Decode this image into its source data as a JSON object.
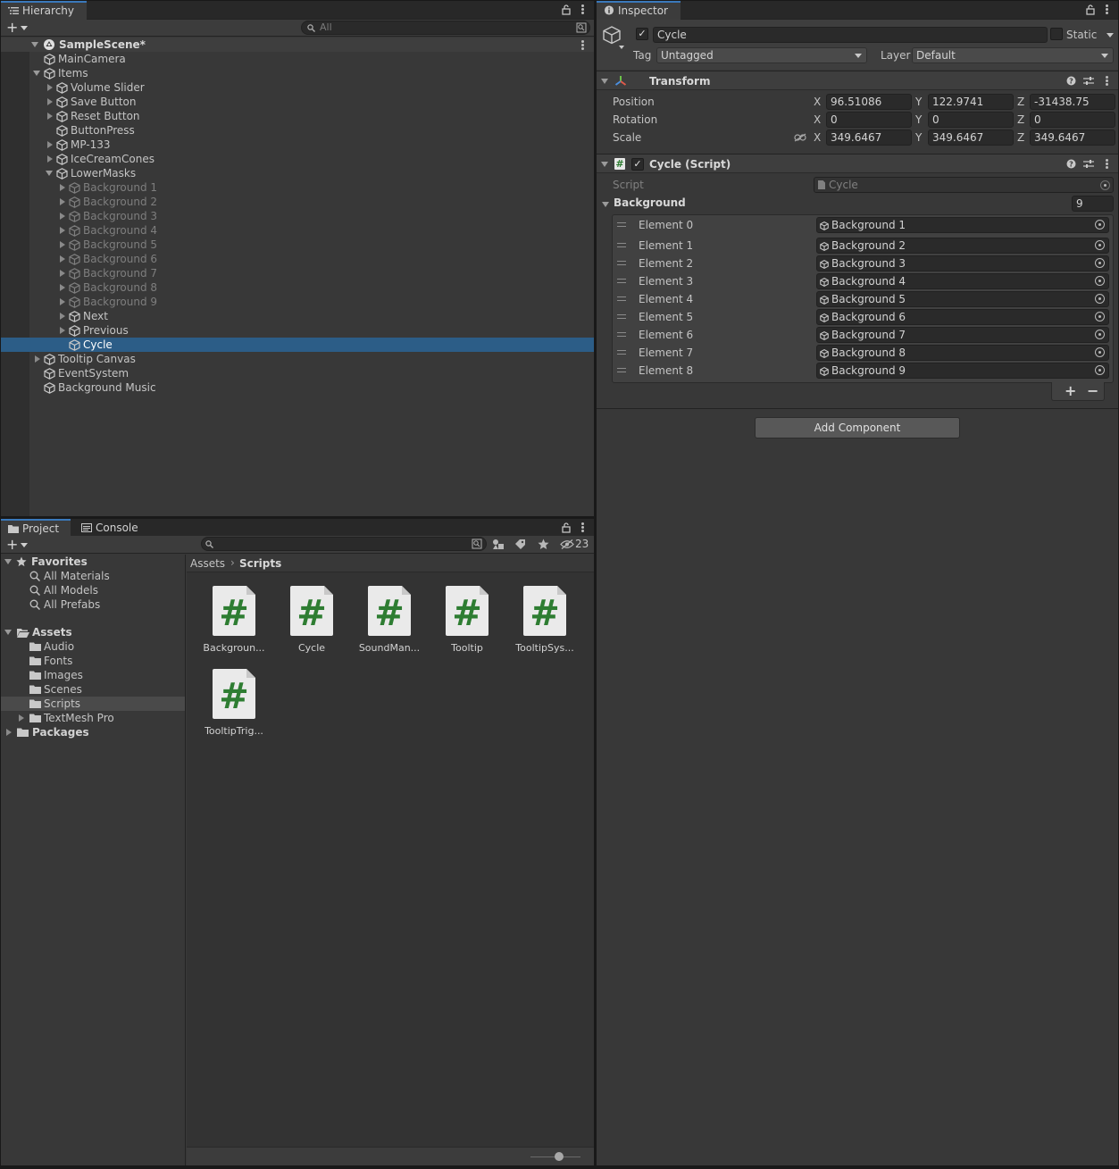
{
  "hierarchy": {
    "tab_label": "Hierarchy",
    "search_placeholder": "All",
    "scene_name": "SampleScene*",
    "items": [
      {
        "label": "MainCamera",
        "depth": 1,
        "expander": "none",
        "faded": false,
        "selected": false
      },
      {
        "label": "Items",
        "depth": 1,
        "expander": "open",
        "faded": false,
        "selected": false
      },
      {
        "label": "Volume Slider",
        "depth": 2,
        "expander": "closed",
        "faded": false,
        "selected": false
      },
      {
        "label": "Save Button",
        "depth": 2,
        "expander": "closed",
        "faded": false,
        "selected": false
      },
      {
        "label": "Reset Button",
        "depth": 2,
        "expander": "closed",
        "faded": false,
        "selected": false
      },
      {
        "label": "ButtonPress",
        "depth": 2,
        "expander": "none",
        "faded": false,
        "selected": false
      },
      {
        "label": "MP-133",
        "depth": 2,
        "expander": "closed",
        "faded": false,
        "selected": false
      },
      {
        "label": "IceCreamCones",
        "depth": 2,
        "expander": "closed",
        "faded": false,
        "selected": false
      },
      {
        "label": "LowerMasks",
        "depth": 2,
        "expander": "open",
        "faded": false,
        "selected": false
      },
      {
        "label": "Background 1",
        "depth": 3,
        "expander": "closed",
        "faded": true,
        "selected": false
      },
      {
        "label": "Background 2",
        "depth": 3,
        "expander": "closed",
        "faded": true,
        "selected": false
      },
      {
        "label": "Background 3",
        "depth": 3,
        "expander": "closed",
        "faded": true,
        "selected": false
      },
      {
        "label": "Background 4",
        "depth": 3,
        "expander": "closed",
        "faded": true,
        "selected": false
      },
      {
        "label": "Background 5",
        "depth": 3,
        "expander": "closed",
        "faded": true,
        "selected": false
      },
      {
        "label": "Background 6",
        "depth": 3,
        "expander": "closed",
        "faded": true,
        "selected": false
      },
      {
        "label": "Background 7",
        "depth": 3,
        "expander": "closed",
        "faded": true,
        "selected": false
      },
      {
        "label": "Background 8",
        "depth": 3,
        "expander": "closed",
        "faded": true,
        "selected": false
      },
      {
        "label": "Background 9",
        "depth": 3,
        "expander": "closed",
        "faded": true,
        "selected": false
      },
      {
        "label": "Next",
        "depth": 3,
        "expander": "closed",
        "faded": false,
        "selected": false
      },
      {
        "label": "Previous",
        "depth": 3,
        "expander": "closed",
        "faded": false,
        "selected": false
      },
      {
        "label": "Cycle",
        "depth": 3,
        "expander": "none",
        "faded": false,
        "selected": true
      },
      {
        "label": "Tooltip Canvas",
        "depth": 1,
        "expander": "closed",
        "faded": false,
        "selected": false
      },
      {
        "label": "EventSystem",
        "depth": 1,
        "expander": "none",
        "faded": false,
        "selected": false
      },
      {
        "label": "Background Music",
        "depth": 1,
        "expander": "none",
        "faded": false,
        "selected": false
      }
    ]
  },
  "project": {
    "tabs": [
      "Project",
      "Console"
    ],
    "hidden_count": "23",
    "favorites_label": "Favorites",
    "favorites": [
      "All Materials",
      "All Models",
      "All Prefabs"
    ],
    "assets_label": "Assets",
    "asset_folders": [
      {
        "label": "Audio",
        "expander": false,
        "selected": false
      },
      {
        "label": "Fonts",
        "expander": false,
        "selected": false
      },
      {
        "label": "Images",
        "expander": false,
        "selected": false
      },
      {
        "label": "Scenes",
        "expander": false,
        "selected": false
      },
      {
        "label": "Scripts",
        "expander": false,
        "selected": true
      },
      {
        "label": "TextMesh Pro",
        "expander": true,
        "selected": false
      }
    ],
    "packages_label": "Packages",
    "breadcrumb": [
      "Assets",
      "Scripts"
    ],
    "files": [
      "Backgroun...",
      "Cycle",
      "SoundMan...",
      "Tooltip",
      "TooltipSys...",
      "TooltipTrig..."
    ]
  },
  "inspector": {
    "tab_label": "Inspector",
    "object_name": "Cycle",
    "static_label": "Static",
    "tag_label": "Tag",
    "tag_value": "Untagged",
    "layer_label": "Layer",
    "layer_value": "Default",
    "transform": {
      "title": "Transform",
      "rows": [
        {
          "label": "Position",
          "x": "96.51086",
          "y": "122.9741",
          "z": "-31438.75"
        },
        {
          "label": "Rotation",
          "x": "0",
          "y": "0",
          "z": "0"
        },
        {
          "label": "Scale",
          "x": "349.6467",
          "y": "349.6467",
          "z": "349.6467"
        }
      ],
      "axis": [
        "X",
        "Y",
        "Z"
      ]
    },
    "script_component": {
      "title": "Cycle (Script)",
      "script_label": "Script",
      "script_value": "Cycle",
      "array_label": "Background",
      "array_size": "9",
      "elements": [
        {
          "label": "Element 0",
          "value": "Background 1"
        },
        {
          "label": "Element 1",
          "value": "Background 2"
        },
        {
          "label": "Element 2",
          "value": "Background 3"
        },
        {
          "label": "Element 3",
          "value": "Background 4"
        },
        {
          "label": "Element 4",
          "value": "Background 5"
        },
        {
          "label": "Element 5",
          "value": "Background 6"
        },
        {
          "label": "Element 6",
          "value": "Background 7"
        },
        {
          "label": "Element 7",
          "value": "Background 8"
        },
        {
          "label": "Element 8",
          "value": "Background 9"
        }
      ],
      "add_symbol": "+",
      "remove_symbol": "−"
    },
    "add_component_label": "Add Component"
  },
  "colors": {
    "selection": "#2c5d87",
    "script_green": "#2e7d32",
    "tab_accent": "#3a79bb"
  }
}
